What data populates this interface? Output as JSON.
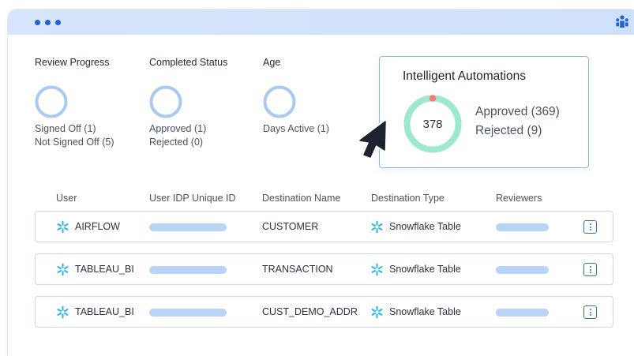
{
  "stats": [
    {
      "title": "Review Progress",
      "lines": [
        "Signed Off (1)",
        "Not Signed Off (5)"
      ]
    },
    {
      "title": "Completed Status",
      "lines": [
        "Approved (1)",
        "Rejected (0)"
      ]
    },
    {
      "title": "Age",
      "lines": [
        "Days Active (1)"
      ]
    }
  ],
  "automations": {
    "title": "Intelligent Automations",
    "total": "378",
    "approved": "Approved (369)",
    "rejected": "Rejected (9)"
  },
  "table": {
    "headers": [
      "User",
      "User IDP Unique ID",
      "Destination Name",
      "Destination Type",
      "Reviewers"
    ],
    "rows": [
      {
        "user": "AIRFLOW",
        "destination_name": "CUSTOMER",
        "destination_type": "Snowflake Table"
      },
      {
        "user": "TABLEAU_BI",
        "destination_name": "TRANSACTION",
        "destination_type": "Snowflake Table"
      },
      {
        "user": "TABLEAU_BI",
        "destination_name": "CUST_DEMO_ADDR",
        "destination_type": "Snowflake Table"
      }
    ]
  },
  "colors": {
    "accent": "#1f63d6",
    "ring": "#a9c9f3",
    "approved": "#9ce9cf",
    "rejected": "#f07b77",
    "snowflake": "#29b5e8",
    "placeholder_pill": "#b9d4f7"
  }
}
